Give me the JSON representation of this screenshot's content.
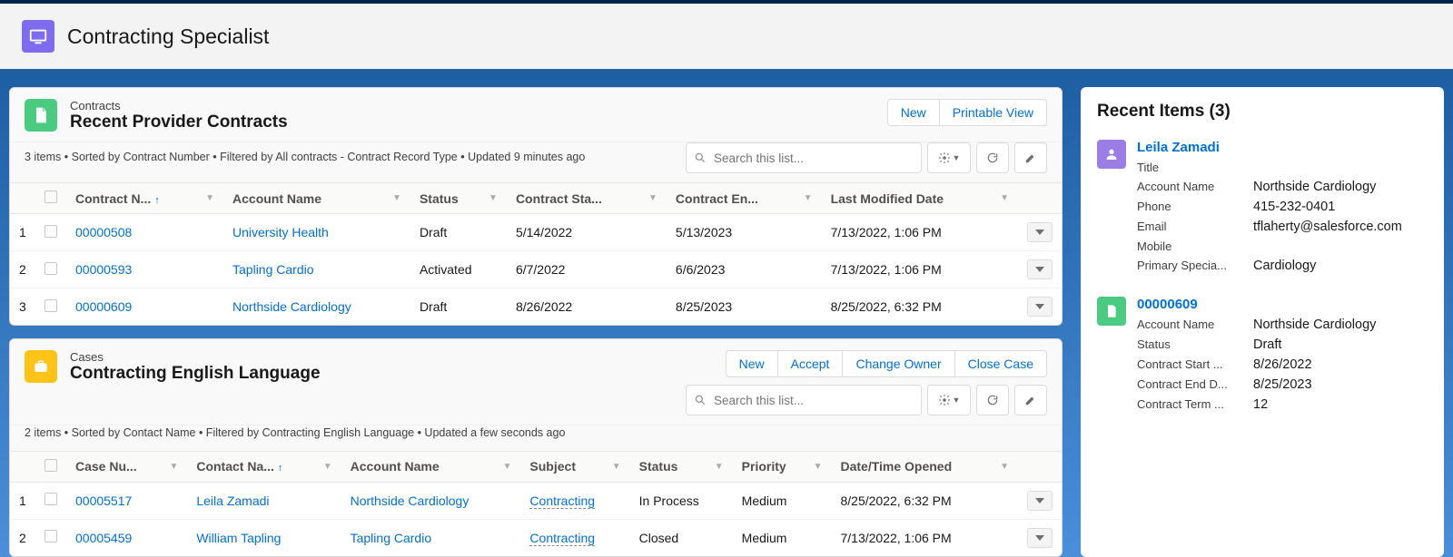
{
  "app": {
    "title": "Contracting Specialist"
  },
  "contracts": {
    "object": "Contracts",
    "list_name": "Recent Provider Contracts",
    "meta": "3 items • Sorted by Contract Number • Filtered by All contracts - Contract Record Type • Updated 9 minutes ago",
    "buttons": {
      "new": "New",
      "printable": "Printable View"
    },
    "search_placeholder": "Search this list...",
    "columns": {
      "contract_no": "Contract N...",
      "account": "Account Name",
      "status": "Status",
      "start": "Contract Sta...",
      "end": "Contract En...",
      "modified": "Last Modified Date"
    },
    "rows": [
      {
        "n": "1",
        "no": "00000508",
        "acct": "University Health",
        "status": "Draft",
        "start": "5/14/2022",
        "end": "5/13/2023",
        "mod": "7/13/2022, 1:06 PM"
      },
      {
        "n": "2",
        "no": "00000593",
        "acct": "Tapling Cardio",
        "status": "Activated",
        "start": "6/7/2022",
        "end": "6/6/2023",
        "mod": "7/13/2022, 1:06 PM"
      },
      {
        "n": "3",
        "no": "00000609",
        "acct": "Northside Cardiology",
        "status": "Draft",
        "start": "8/26/2022",
        "end": "8/25/2023",
        "mod": "8/25/2022, 6:32 PM"
      }
    ]
  },
  "cases": {
    "object": "Cases",
    "list_name": "Contracting English Language",
    "meta": "2 items • Sorted by Contact Name • Filtered by Contracting English Language • Updated a few seconds ago",
    "buttons": {
      "new": "New",
      "accept": "Accept",
      "change_owner": "Change Owner",
      "close": "Close Case"
    },
    "search_placeholder": "Search this list...",
    "columns": {
      "case_no": "Case Nu...",
      "contact": "Contact Na...",
      "account": "Account Name",
      "subject": "Subject",
      "status": "Status",
      "priority": "Priority",
      "opened": "Date/Time Opened"
    },
    "rows": [
      {
        "n": "1",
        "no": "00005517",
        "contact": "Leila Zamadi",
        "acct": "Northside Cardiology",
        "subject": "Contracting",
        "status": "In Process",
        "priority": "Medium",
        "opened": "8/25/2022, 6:32 PM"
      },
      {
        "n": "2",
        "no": "00005459",
        "contact": "William Tapling",
        "acct": "Tapling Cardio",
        "subject": "Contracting",
        "status": "Closed",
        "priority": "Medium",
        "opened": "7/13/2022, 1:06 PM"
      }
    ]
  },
  "recent": {
    "title": "Recent Items (3)",
    "items": [
      {
        "type": "contact",
        "name": "Leila Zamadi",
        "fields": [
          {
            "label": "Title",
            "value": ""
          },
          {
            "label": "Account Name",
            "value": "Northside Cardiology"
          },
          {
            "label": "Phone",
            "value": "415-232-0401"
          },
          {
            "label": "Email",
            "value": "tflaherty@salesforce.com",
            "link": true
          },
          {
            "label": "Mobile",
            "value": ""
          },
          {
            "label": "Primary Specia...",
            "value": "Cardiology"
          }
        ]
      },
      {
        "type": "contract",
        "name": "00000609",
        "fields": [
          {
            "label": "Account Name",
            "value": "Northside Cardiology"
          },
          {
            "label": "Status",
            "value": "Draft"
          },
          {
            "label": "Contract Start ...",
            "value": "8/26/2022"
          },
          {
            "label": "Contract End D...",
            "value": "8/25/2023"
          },
          {
            "label": "Contract Term ...",
            "value": "12"
          }
        ]
      }
    ]
  }
}
